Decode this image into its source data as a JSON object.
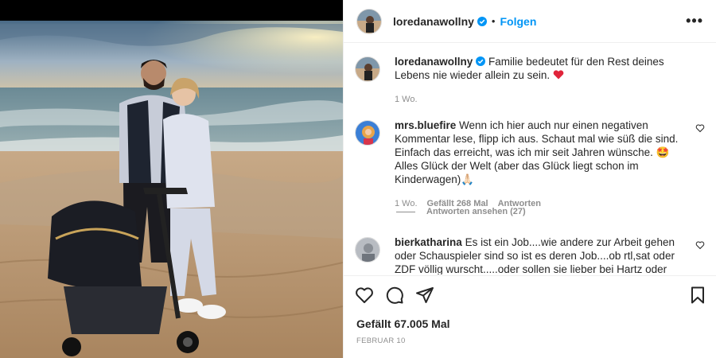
{
  "post": {
    "username": "loredanawollny",
    "separator": "•",
    "follow_label": "Folgen",
    "more_label": "•••",
    "caption": "Familie bedeutet für den Rest deines Lebens nie wieder allein zu sein.",
    "caption_time": "1 Wo.",
    "likes_text": "Gefällt 67.005 Mal",
    "date_text": "FEBRUAR 10"
  },
  "comments": [
    {
      "username": "mrs.bluefire",
      "text": "Wenn ich hier auch nur einen negativen Kommentar lese, flipp ich aus. Schaut mal wie süß die sind. Einfach das erreicht, was ich mir seit Jahren wünsche. 🤩 Alles Glück der Welt (aber das Glück liegt schon im Kinderwagen)🙏🏻",
      "time": "1 Wo.",
      "likes": "Gefällt 268 Mal",
      "reply_label": "Antworten",
      "view_replies": "Antworten ansehen (27)"
    },
    {
      "username": "bierkatharina",
      "text": "Es ist ein Job....wie andere zur Arbeit gehen oder Schauspieler sind so ist es deren Job....ob rtl,sat oder ZDF völlig wurscht.....oder sollen sie lieber bei Hartz oder herzlich spielen?"
    }
  ],
  "colors": {
    "accent": "#0095f6",
    "verified": "#0095f6",
    "heart": "#ed4956",
    "muted": "#8e8e8e"
  },
  "icons": [
    "verified-icon",
    "more-icon",
    "heart-icon",
    "comment-icon",
    "share-icon",
    "bookmark-icon"
  ]
}
